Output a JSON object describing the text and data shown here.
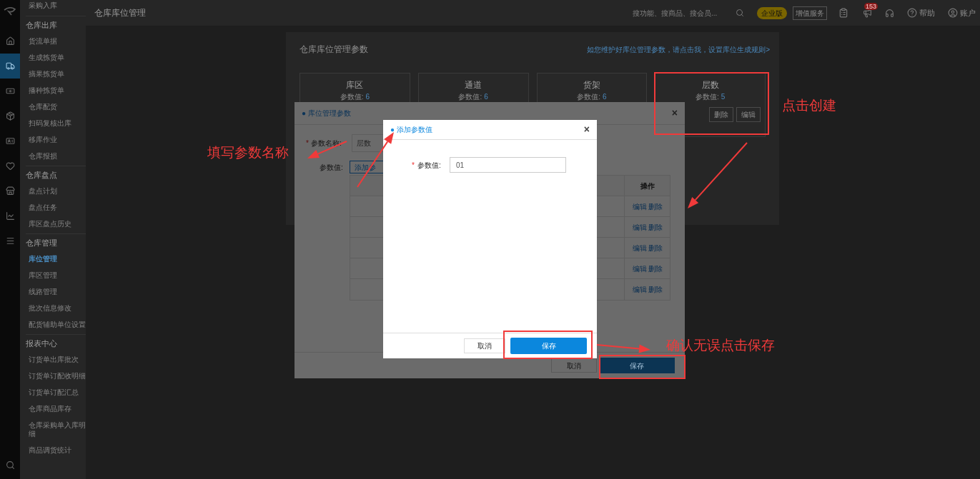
{
  "rail": [
    {
      "kind": "logo"
    },
    {
      "kind": "home",
      "selected": false
    },
    {
      "kind": "truck",
      "selected": true
    },
    {
      "kind": "money",
      "selected": false
    },
    {
      "kind": "box",
      "selected": false
    },
    {
      "kind": "card",
      "selected": false
    },
    {
      "kind": "heart",
      "selected": false
    },
    {
      "kind": "store",
      "selected": false
    },
    {
      "kind": "chart",
      "selected": false
    },
    {
      "kind": "menu",
      "selected": false
    },
    {
      "kind": "search",
      "selected": false
    }
  ],
  "sidebar": {
    "top_item": "采购入库",
    "groups": [
      {
        "title": "仓库出库",
        "items": [
          {
            "label": "货流单据",
            "selected": false
          },
          {
            "label": "生成拣货单",
            "selected": false
          },
          {
            "label": "摘果拣货单",
            "selected": false
          },
          {
            "label": "播种拣货单",
            "selected": false
          },
          {
            "label": "仓库配货",
            "selected": false
          },
          {
            "label": "扫码复核出库",
            "selected": false
          },
          {
            "label": "移库作业",
            "selected": false
          },
          {
            "label": "仓库报损",
            "selected": false
          }
        ]
      },
      {
        "title": "仓库盘点",
        "items": [
          {
            "label": "盘点计划",
            "selected": false
          },
          {
            "label": "盘点任务",
            "selected": false
          },
          {
            "label": "库区盘点历史",
            "selected": false
          }
        ]
      },
      {
        "title": "仓库管理",
        "items": [
          {
            "label": "库位管理",
            "selected": true
          },
          {
            "label": "库区管理",
            "selected": false
          },
          {
            "label": "线路管理",
            "selected": false
          },
          {
            "label": "批次信息修改",
            "selected": false
          },
          {
            "label": "配货辅助单位设置",
            "selected": false
          }
        ]
      },
      {
        "title": "报表中心",
        "items": [
          {
            "label": "订货单出库批次",
            "selected": false
          },
          {
            "label": "订货单订配收明细",
            "selected": false
          },
          {
            "label": "订货单订配汇总",
            "selected": false
          },
          {
            "label": "仓库商品库存",
            "selected": false
          },
          {
            "label": "仓库采购单入库明细",
            "selected": false
          },
          {
            "label": "商品调货统计",
            "selected": false
          }
        ]
      }
    ]
  },
  "topbar": {
    "title": "仓库库位管理",
    "search_placeholder": "搜功能、搜商品、搜会员...",
    "edition_badge": "企业版",
    "service_button": "增值服务",
    "notification_count": "153",
    "help": "帮助",
    "account": "账户"
  },
  "page": {
    "title": "仓库库位管理参数",
    "link": "如您维护好库位管理参数，请点击我，设置库位生成规则>",
    "cards": [
      {
        "name": "库区",
        "value_label": "参数值:",
        "value": "6"
      },
      {
        "name": "通道",
        "value_label": "参数值:",
        "value": "6"
      },
      {
        "name": "货架",
        "value_label": "参数值:",
        "value": "6"
      },
      {
        "name": "层数",
        "value_label": "参数值:",
        "value": "5",
        "actions": [
          "删除",
          "编辑"
        ]
      }
    ]
  },
  "dialog": {
    "bullet": "●",
    "title": "库位管理参数",
    "close": "×",
    "required_mark": "*",
    "name_label": "参数名称:",
    "name_value": "层数",
    "values_label": "参数值:",
    "add_button": "添加参",
    "table": {
      "action_header": "操作",
      "rows": [
        [
          "编辑",
          "删除"
        ],
        [
          "编辑",
          "删除"
        ],
        [
          "编辑",
          "删除"
        ],
        [
          "编辑",
          "删除"
        ],
        [
          "编辑",
          "删除"
        ]
      ]
    },
    "cancel": "取消",
    "save": "保存"
  },
  "add_dialog": {
    "bullet": "●",
    "title": "添加参数值",
    "close": "×",
    "required_mark": "*",
    "field_label": "参数值:",
    "field_value": "01",
    "cancel": "取消",
    "save": "保存"
  },
  "annotations": [
    {
      "text": "填写参数名称"
    },
    {
      "text": "点击创建"
    },
    {
      "text": "确认无误点击保存"
    }
  ]
}
